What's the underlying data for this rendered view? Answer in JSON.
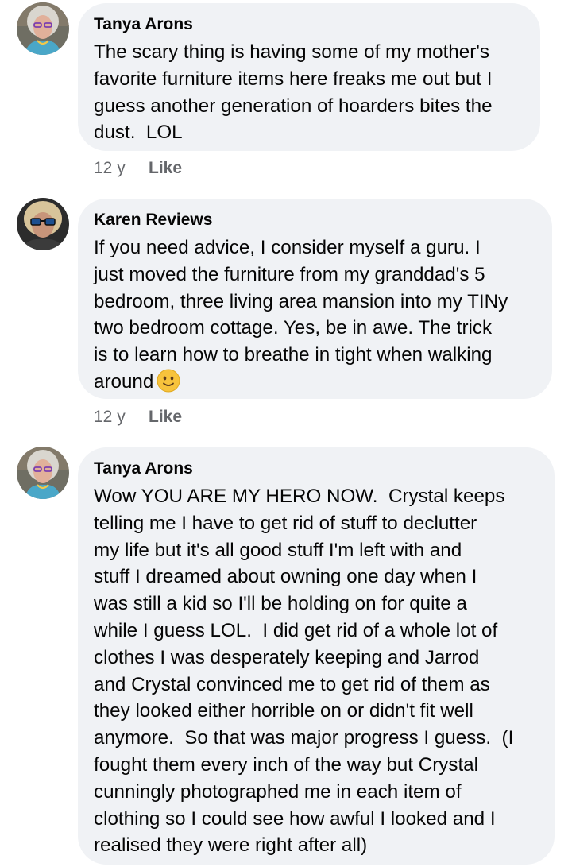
{
  "comments": [
    {
      "author": "Tanya Arons",
      "text": "The scary thing is having some of my mother's\nfavorite furniture items here freaks me out but I\nguess another generation of hoarders bites the\ndust.  LOL",
      "time": "12 y",
      "like_label": "Like"
    },
    {
      "author": "Karen Reviews",
      "text": "If you need advice, I consider myself a guru. I\njust moved the furniture from my granddad's 5\nbedroom, three living area mansion into my TINy\ntwo bedroom cottage. Yes, be in awe. The trick\nis to learn how to breathe in tight when walking\naround",
      "emoji": "slightly-smiling-face",
      "time": "12 y",
      "like_label": "Like"
    },
    {
      "author": "Tanya Arons",
      "text": "Wow YOU ARE MY HERO NOW.  Crystal keeps\ntelling me I have to get rid of stuff to declutter\nmy life but it's all good stuff I'm left with and\nstuff I dreamed about owning one day when I\nwas still a kid so I'll be holding on for quite a\nwhile I guess LOL.  I did get rid of a whole lot of\nclothes I was desperately keeping and Jarrod\nand Crystal convinced me to get rid of them as\nthey looked either horrible on or didn't fit well\nanymore.  So that was major progress I guess.  (I\nfought them every inch of the way but Crystal\ncunningly photographed me in each item of\nclothing so I could see how awful I looked and I\nrealised they were right after all)"
    }
  ],
  "colors": {
    "bubble": "#f0f2f5",
    "text": "#050505",
    "meta": "#65676b"
  }
}
